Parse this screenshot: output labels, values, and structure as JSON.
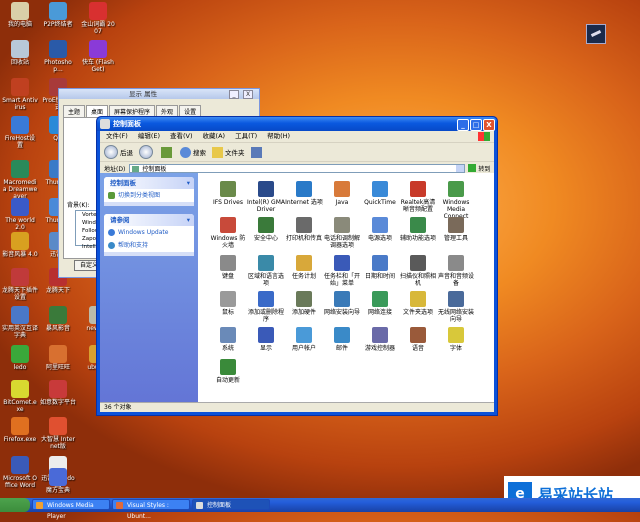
{
  "desktop": {
    "icons": [
      {
        "label": "我的电脑",
        "color": "#d9d0a8"
      },
      {
        "label": "回收站",
        "color": "#b8c8d8"
      },
      {
        "label": "Smart Antivirus",
        "color": "#c04020"
      },
      {
        "label": "FireHost设置",
        "color": "#3a7ad8"
      },
      {
        "label": "Macromedia Dreamweaver",
        "color": "#2a8a5a"
      },
      {
        "label": "The world 2.0",
        "color": "#3a5ac8"
      },
      {
        "label": "影音风暴 4.0",
        "color": "#d8a020"
      },
      {
        "label": "龙腾天下插件设置",
        "color": "#c03a3a"
      },
      {
        "label": "实用英汉互译字典",
        "color": "#4a78c8"
      },
      {
        "label": "ledo",
        "color": "#3aa83a"
      },
      {
        "label": "BitComet.exe",
        "color": "#d8d830"
      },
      {
        "label": "Firefox.exe",
        "color": "#e07020"
      },
      {
        "label": "Microsoft Office Word",
        "color": "#3a5ab8"
      },
      {
        "label": "P2P终结者",
        "color": "#4a9ad8"
      },
      {
        "label": "Photoshop...",
        "color": "#2a5aa8"
      },
      {
        "label": "ProE快捷方式",
        "color": "#a83a3a"
      },
      {
        "label": "QQ",
        "color": "#2a8ad8"
      },
      {
        "label": "Thunder",
        "color": "#3a7ac8"
      },
      {
        "label": "Thunder",
        "color": "#4a8ad8"
      },
      {
        "label": "迅雷5",
        "color": "#5a8ac8"
      },
      {
        "label": "龙腾天下",
        "color": "#b83030"
      },
      {
        "label": "暴风影音",
        "color": "#3a7a3a"
      },
      {
        "label": "阿里旺旺",
        "color": "#d87030"
      },
      {
        "label": "如意数字平台",
        "color": "#c83a3a"
      },
      {
        "label": "大智慧 Internet版",
        "color": "#e05030"
      },
      {
        "label": "迅雷出租 docs",
        "color": "#ededed"
      },
      {
        "label": "魔方宝典",
        "color": "#4a6ad8"
      },
      {
        "label": "金山词霸 2007",
        "color": "#d83030"
      },
      {
        "label": "快车 (FlashGet)",
        "color": "#8a3ad8"
      },
      {
        "label": "new.a...",
        "color": "#bbbbaa"
      },
      {
        "label": "ubuntu",
        "color": "#d8a030"
      }
    ]
  },
  "back_window": {
    "title": "显示 属性",
    "min": "_",
    "close": "X",
    "tabs": [
      "主题",
      "桌面",
      "屏幕保护程序",
      "外观",
      "设置"
    ],
    "bg_label": "背景(K):",
    "bg_items": [
      "Vortec",
      "Wind",
      "Follow",
      "Zapote",
      "Intell"
    ],
    "button": "自定义桌面"
  },
  "window": {
    "title": "控制面板",
    "min": "_",
    "max": "□",
    "close": "X",
    "menu": [
      "文件(F)",
      "编辑(E)",
      "查看(V)",
      "收藏(A)",
      "工具(T)",
      "帮助(H)"
    ],
    "toolbar": {
      "back": "后退",
      "search": "搜索",
      "folders": "文件夹"
    },
    "address_label": "地址(D)",
    "address_value": "控制面板",
    "go": "转到",
    "sidebar": {
      "panel1_title": "控制面板",
      "panel1_items": [
        "切换到分类视图"
      ],
      "panel2_title": "请参阅",
      "panel2_items": [
        "Windows Update",
        "帮助和支持"
      ],
      "chevron": "▾"
    },
    "items": [
      {
        "label": "IFS Drives",
        "color": "#6a8a4a"
      },
      {
        "label": "Intel(R) GMA Driver",
        "color": "#2a4a8a"
      },
      {
        "label": "Internet 选项",
        "color": "#2a7ac8"
      },
      {
        "label": "Java",
        "color": "#d87a3a"
      },
      {
        "label": "QuickTime",
        "color": "#3a8ad8"
      },
      {
        "label": "Realtek高清晰音频配置",
        "color": "#c83a2a"
      },
      {
        "label": "Windows Media Connect",
        "color": "#4a9a4a"
      },
      {
        "label": "Windows 防火墙",
        "color": "#c84a3a"
      },
      {
        "label": "安全中心",
        "color": "#3a7a3a"
      },
      {
        "label": "打印机和传真",
        "color": "#6a6a6a"
      },
      {
        "label": "电话和调制解调器选项",
        "color": "#8a8a7a"
      },
      {
        "label": "电源选项",
        "color": "#5a8ad8"
      },
      {
        "label": "辅助功能选项",
        "color": "#3a8a4a"
      },
      {
        "label": "管理工具",
        "color": "#7a6a5a"
      },
      {
        "label": "键盘",
        "color": "#8a8a8a"
      },
      {
        "label": "区域和语言选项",
        "color": "#3a8aa8"
      },
      {
        "label": "任务计划",
        "color": "#d8a83a"
      },
      {
        "label": "任务栏和「开始」菜单",
        "color": "#3a5ab8"
      },
      {
        "label": "日期和时间",
        "color": "#4a7ac8"
      },
      {
        "label": "扫描仪和照相机",
        "color": "#5a5a5a"
      },
      {
        "label": "声音和音频设备",
        "color": "#8a8a8a"
      },
      {
        "label": "鼠标",
        "color": "#9a9a9a"
      },
      {
        "label": "添加或删除程序",
        "color": "#3a6ac8"
      },
      {
        "label": "添加硬件",
        "color": "#6a7a5a"
      },
      {
        "label": "网络安装向导",
        "color": "#3a7ab8"
      },
      {
        "label": "网络连接",
        "color": "#3a9a5a"
      },
      {
        "label": "文件夹选项",
        "color": "#d8b83a"
      },
      {
        "label": "无线网络安装向导",
        "color": "#4a6a9a"
      },
      {
        "label": "系统",
        "color": "#6a8ab8"
      },
      {
        "label": "显示",
        "color": "#3a5ab8"
      },
      {
        "label": "用户帐户",
        "color": "#4a9ad8"
      },
      {
        "label": "邮件",
        "color": "#3a8ac8"
      },
      {
        "label": "游戏控制器",
        "color": "#6a6aa8"
      },
      {
        "label": "语音",
        "color": "#9a5a3a"
      },
      {
        "label": "字体",
        "color": "#d8c83a"
      },
      {
        "label": "自动更新",
        "color": "#3a8a3a"
      }
    ],
    "status": "36 个对象"
  },
  "taskbar": {
    "buttons": [
      "Windows Media Player",
      "Visual Styles : Ubunt...",
      "控制面板"
    ]
  },
  "watermark": {
    "text": "易采站长站",
    "sub": "www.easck.com"
  }
}
